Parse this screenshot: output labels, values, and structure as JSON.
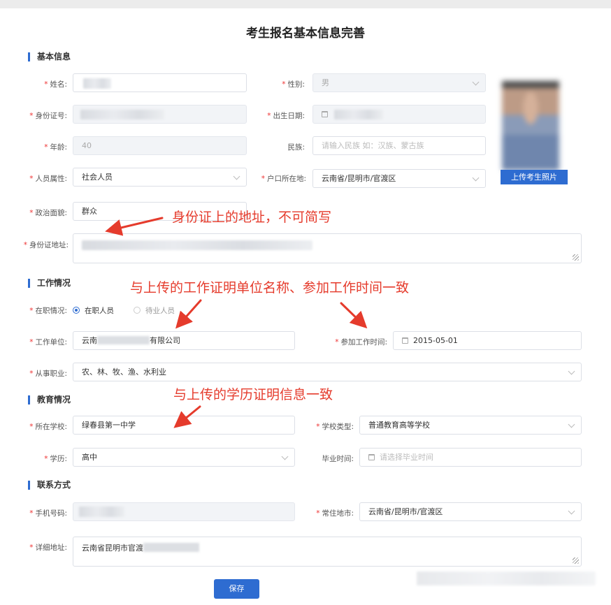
{
  "page": {
    "title": "考生报名基本信息完善"
  },
  "sections": {
    "basic": "基本信息",
    "work": "工作情况",
    "education": "教育情况",
    "contact": "联系方式"
  },
  "basic": {
    "name_label": "姓名:",
    "gender_label": "性别:",
    "gender_value": "男",
    "id_label": "身份证号:",
    "birth_label": "出生日期:",
    "age_label": "年龄:",
    "age_value": "40",
    "ethnic_label": "民族:",
    "ethnic_placeholder": "请输入民族 如：汉族、蒙古族",
    "category_label": "人员属性:",
    "category_value": "社会人员",
    "hukou_label": "户口所在地:",
    "hukou_value": "云南省/昆明市/官渡区",
    "political_label": "政治面貌:",
    "political_value": "群众",
    "address_label": "身份证地址:",
    "photo_button": "上传考生照片"
  },
  "work": {
    "status_label": "在职情况:",
    "status_options": [
      "在职人员",
      "待业人员"
    ],
    "status_selected": "在职人员",
    "employer_label": "工作单位:",
    "employer_prefix": "云南",
    "employer_suffix": "有限公司",
    "start_label": "参加工作时间:",
    "start_value": "2015-05-01",
    "occupation_label": "从事职业:",
    "occupation_value": "农、林、牧、渔、水利业"
  },
  "education": {
    "school_label": "所在学校:",
    "school_value": "绿春县第一中学",
    "type_label": "学校类型:",
    "type_value": "普通教育高等学校",
    "degree_label": "学历:",
    "degree_value": "高中",
    "grad_label": "毕业时间:",
    "grad_placeholder": "请选择毕业时间"
  },
  "contact": {
    "phone_label": "手机号码:",
    "residence_label": "常住地市:",
    "residence_value": "云南省/昆明市/官渡区",
    "detail_label": "详细地址:",
    "detail_value": "云南省昆明市官渡"
  },
  "actions": {
    "save": "保存"
  },
  "annotations": {
    "id_address": "身份证上的地址，不可简写",
    "work_match": "与上传的工作证明单位名称、参加工作时间一致",
    "edu_match": "与上传的学历证明信息一致"
  },
  "colors": {
    "accent": "#2e6cd1",
    "annotation": "#e53b2c",
    "required": "#e33333"
  }
}
